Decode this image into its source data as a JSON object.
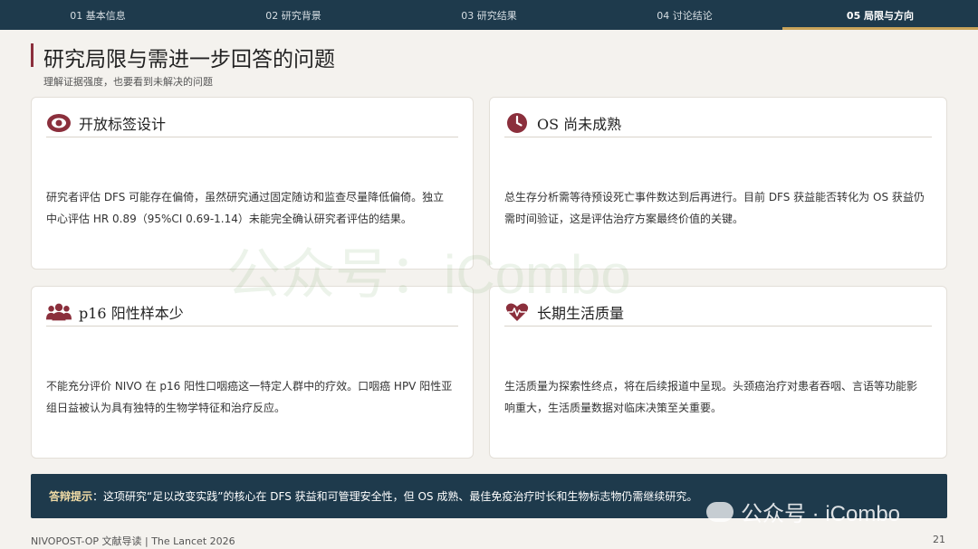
{
  "nav": {
    "tabs": [
      {
        "label": "01 基本信息"
      },
      {
        "label": "02 研究背景"
      },
      {
        "label": "03 研究结果"
      },
      {
        "label": "04 讨论结论"
      },
      {
        "label": "05 局限与方向"
      }
    ],
    "active_index": 4
  },
  "page": {
    "title": "研究局限与需进一步回答的问题",
    "subtitle": "理解证据强度，也要看到未解决的问题"
  },
  "cards": [
    {
      "icon": "eye-icon",
      "title": "开放标签设计",
      "body": "研究者评估 DFS 可能存在偏倚，虽然研究通过固定随访和监查尽量降低偏倚。独立中心评估 HR 0.89（95%CI 0.69-1.14）未能完全确认研究者评估的结果。"
    },
    {
      "icon": "clock-icon",
      "title": "OS 尚未成熟",
      "body": "总生存分析需等待预设死亡事件数达到后再进行。目前 DFS 获益能否转化为 OS 获益仍需时间验证，这是评估治疗方案最终价值的关键。"
    },
    {
      "icon": "users-icon",
      "title": "p16 阳性样本少",
      "body": "不能充分评价 NIVO 在 p16 阳性口咽癌这一特定人群中的疗效。口咽癌 HPV 阳性亚组日益被认为具有独特的生物学特征和治疗反应。"
    },
    {
      "icon": "heartbeat-icon",
      "title": "长期生活质量",
      "body": "生活质量为探索性终点，将在后续报道中呈现。头颈癌治疗对患者吞咽、言语等功能影响重大，生活质量数据对临床决策至关重要。"
    }
  ],
  "banner": {
    "label": "答辩提示",
    "text": "：这项研究“足以改变实践”的核心在 DFS 获益和可管理安全性，但 OS 成熟、最佳免疫治疗时长和生物标志物仍需继续研究。"
  },
  "footer": {
    "left": "NIVOPOST-OP 文献导读 | The Lancet 2026",
    "page_number": "21"
  },
  "watermark": {
    "center": "公众号：iCombo",
    "corner": "公众号 · iCombo"
  },
  "colors": {
    "nav_bg": "#1e3a4c",
    "accent": "#8b2f3c",
    "tab_underline": "#c9a35a",
    "page_bg": "#f4f2ee"
  }
}
